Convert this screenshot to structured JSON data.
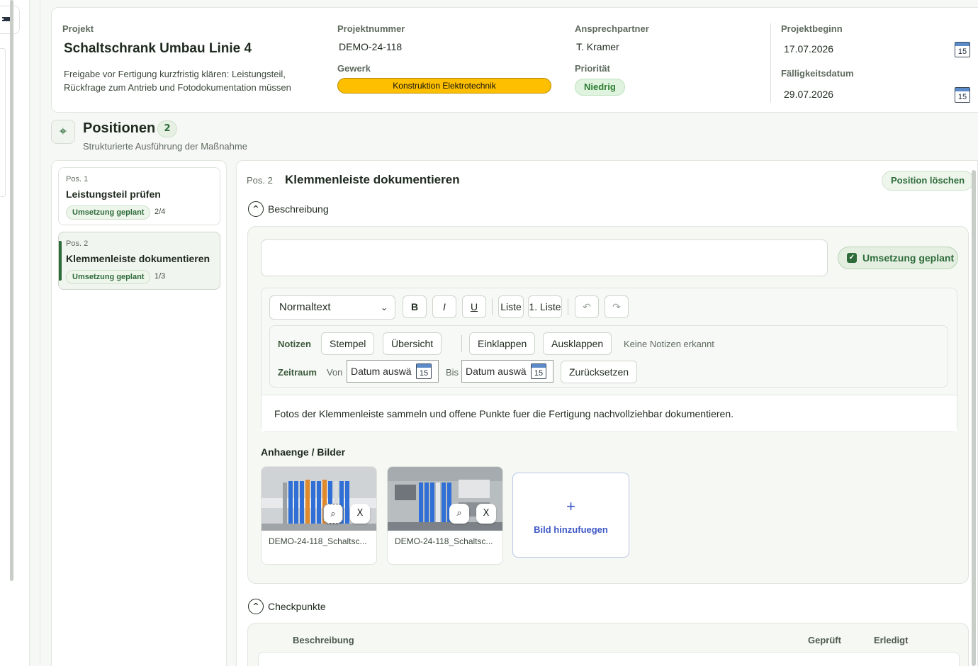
{
  "header": {
    "projekt_label": "Projekt",
    "projekt_title": "Schaltschrank Umbau Linie 4",
    "projekt_desc": "Freigabe vor Fertigung kurzfristig klären: Leistungsteil, Rückfrage zum Antrieb und Fotodokumentation müssen",
    "projektnummer_label": "Projektnummer",
    "projektnummer": "DEMO-24-118",
    "gewerk_label": "Gewerk",
    "gewerk": "Konstruktion Elektrotechnik",
    "ansprechpartner_label": "Ansprechpartner",
    "ansprechpartner": "T. Kramer",
    "prioritaet_label": "Priorität",
    "prioritaet": "Niedrig",
    "projektbeginn_label": "Projektbeginn",
    "projektbeginn": "17.07.2026",
    "faelligkeit_label": "Fälligkeitsdatum",
    "faelligkeit": "29.07.2026",
    "calendar_day": "15"
  },
  "positions": {
    "title": "Positionen",
    "count": "2",
    "subtitle": "Strukturierte Ausführung der Maßnahme",
    "items": [
      {
        "num": "Pos. 1",
        "title": "Leistungsteil prüfen",
        "status": "Umsetzung geplant",
        "progress": "2/4"
      },
      {
        "num": "Pos. 2",
        "title": "Klemmenleiste dokumentieren",
        "status": "Umsetzung geplant",
        "progress": "1/3"
      }
    ]
  },
  "detail": {
    "pos_num": "Pos. 2",
    "title": "Klemmenleiste dokumentieren",
    "delete_label": "Position löschen",
    "beschreibung_label": "Beschreibung",
    "status_label": "Umsetzung geplant",
    "toolbar": {
      "format": "Normaltext",
      "bold": "B",
      "italic": "I",
      "underline": "U",
      "list": "Liste",
      "numlist": "1. Liste"
    },
    "notes": {
      "label": "Notizen",
      "stempel": "Stempel",
      "uebersicht": "Übersicht",
      "einklappen": "Einklappen",
      "ausklappen": "Ausklappen",
      "none": "Keine Notizen erkannt",
      "zeitraum": "Zeitraum",
      "von": "Von",
      "bis": "Bis",
      "date_placeholder": "Datum auswä",
      "reset": "Zurücksetzen"
    },
    "text": "Fotos der Klemmenleiste sammeln und offene Punkte fuer die Fertigung nachvollziehbar dokumentieren.",
    "attachments_label": "Anhaenge / Bilder",
    "attachments": [
      {
        "name": "DEMO-24-118_Schaltsc..."
      },
      {
        "name": "DEMO-24-118_Schaltsc..."
      }
    ],
    "add_plus": "+",
    "add_image": "Bild hinzufuegen",
    "checkpunkte_label": "Checkpunkte",
    "checks_header": {
      "beschreibung": "Beschreibung",
      "geprueft": "Geprüft",
      "erledigt": "Erledigt"
    }
  }
}
